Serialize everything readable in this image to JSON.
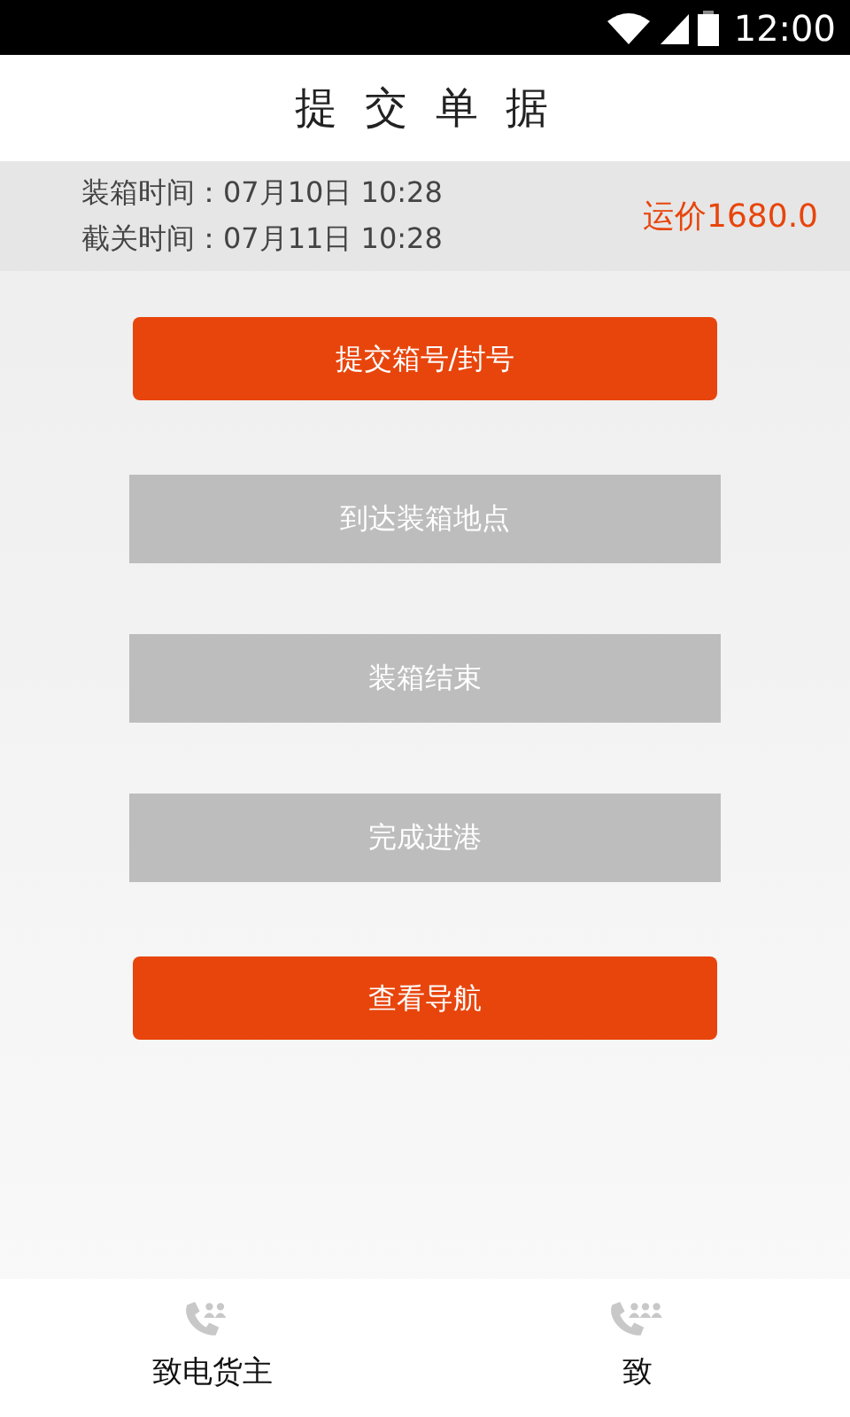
{
  "status_bar": {
    "time": "12:00"
  },
  "header": {
    "title": "提 交 单 据"
  },
  "info": {
    "lines": [
      "装箱时间：07月10日 10:28",
      "截关时间：07月11日 10:28"
    ],
    "price": "运价1680.0"
  },
  "actions": [
    {
      "label": "提交箱号/封号",
      "disabled": false
    },
    {
      "label": "到达装箱地点",
      "disabled": true
    },
    {
      "label": "装箱结束",
      "disabled": true
    },
    {
      "label": "完成进港",
      "disabled": true
    },
    {
      "label": "查看导航",
      "disabled": false
    }
  ],
  "bottom_tabs": [
    {
      "label": "致电货主"
    },
    {
      "label": "致"
    }
  ]
}
